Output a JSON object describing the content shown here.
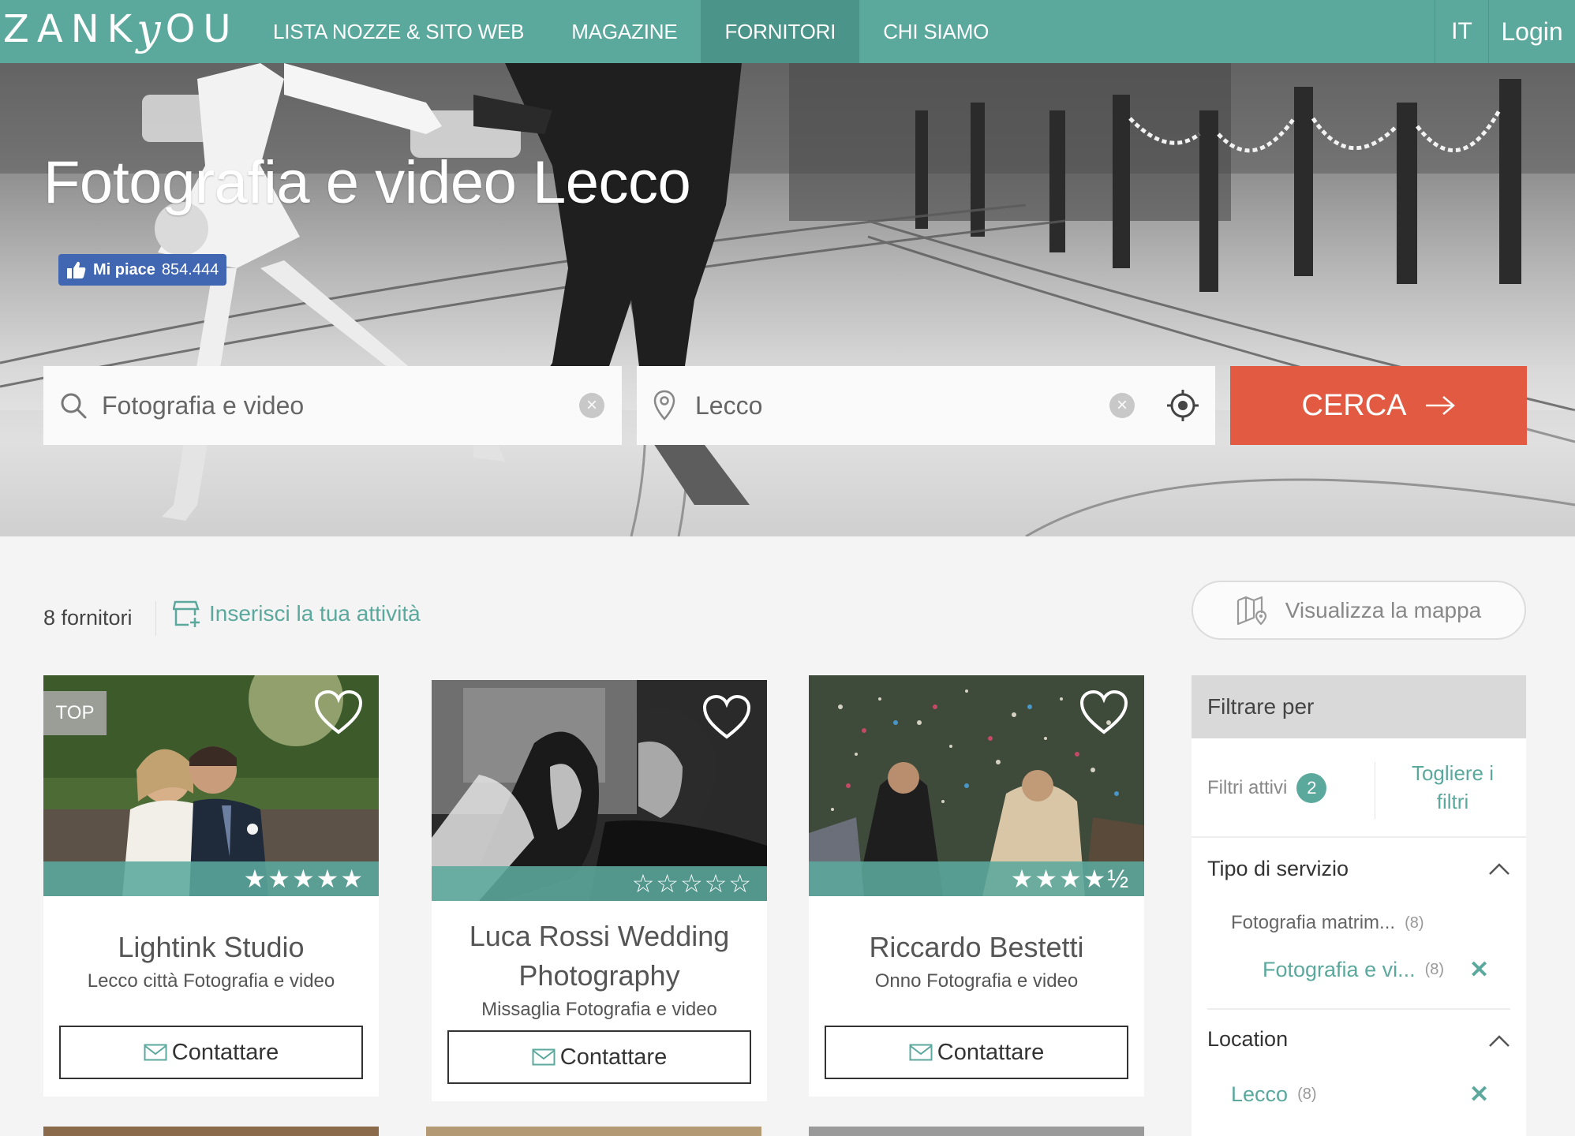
{
  "nav": {
    "logo": "ZANKYOU",
    "logo_parts": {
      "pre": "ZANK",
      "y": "y",
      "post": "OU"
    },
    "items": [
      "LISTA NOZZE & SITO WEB",
      "MAGAZINE",
      "FORNITORI",
      "CHI SIAMO"
    ],
    "active_item": "FORNITORI",
    "lang": "IT",
    "login": "Login"
  },
  "hero": {
    "title": "Fotografia e video Lecco",
    "fb_like": {
      "label": "Mi piace",
      "count": "854.444"
    }
  },
  "search": {
    "what_value": "Fotografia e video",
    "where_value": "Lecco",
    "button_label": "CERCA"
  },
  "results": {
    "count_label": "8 fornitori",
    "add_business_label": "Inserisci la tua attività",
    "map_button_label": "Visualizza la mappa"
  },
  "cards": [
    {
      "name": "Lightink Studio",
      "subtitle": "Lecco città Fotografia e video",
      "badge": "TOP",
      "stars": "★★★★★",
      "rating": 5,
      "contact_label": "Contattare"
    },
    {
      "name": "Luca Rossi Wedding Photography",
      "subtitle": "Missaglia Fotografia e video",
      "badge": "",
      "stars": "☆☆☆☆☆",
      "rating": 0,
      "contact_label": "Contattare"
    },
    {
      "name": "Riccardo Bestetti",
      "subtitle": "Onno Fotografia e video",
      "badge": "",
      "stars": "★★★★½",
      "rating": 4.5,
      "contact_label": "Contattare"
    }
  ],
  "filters": {
    "title": "Filtrare per",
    "active_label": "Filtri attivi",
    "active_count": "2",
    "clear_label": "Togliere i filtri",
    "sections": [
      {
        "title": "Tipo di servizio",
        "options": [
          {
            "label": "Fotografia matrim...",
            "count": "(8)",
            "selected": false
          },
          {
            "label": "Fotografia e vi...",
            "count": "(8)",
            "selected": true
          }
        ]
      },
      {
        "title": "Location",
        "options": [
          {
            "label": "Lecco",
            "count": "(8)",
            "selected": true
          }
        ]
      }
    ]
  },
  "colors": {
    "brand": "#5ba89d",
    "cta": "#e25a41",
    "facebook": "#4267b2"
  }
}
